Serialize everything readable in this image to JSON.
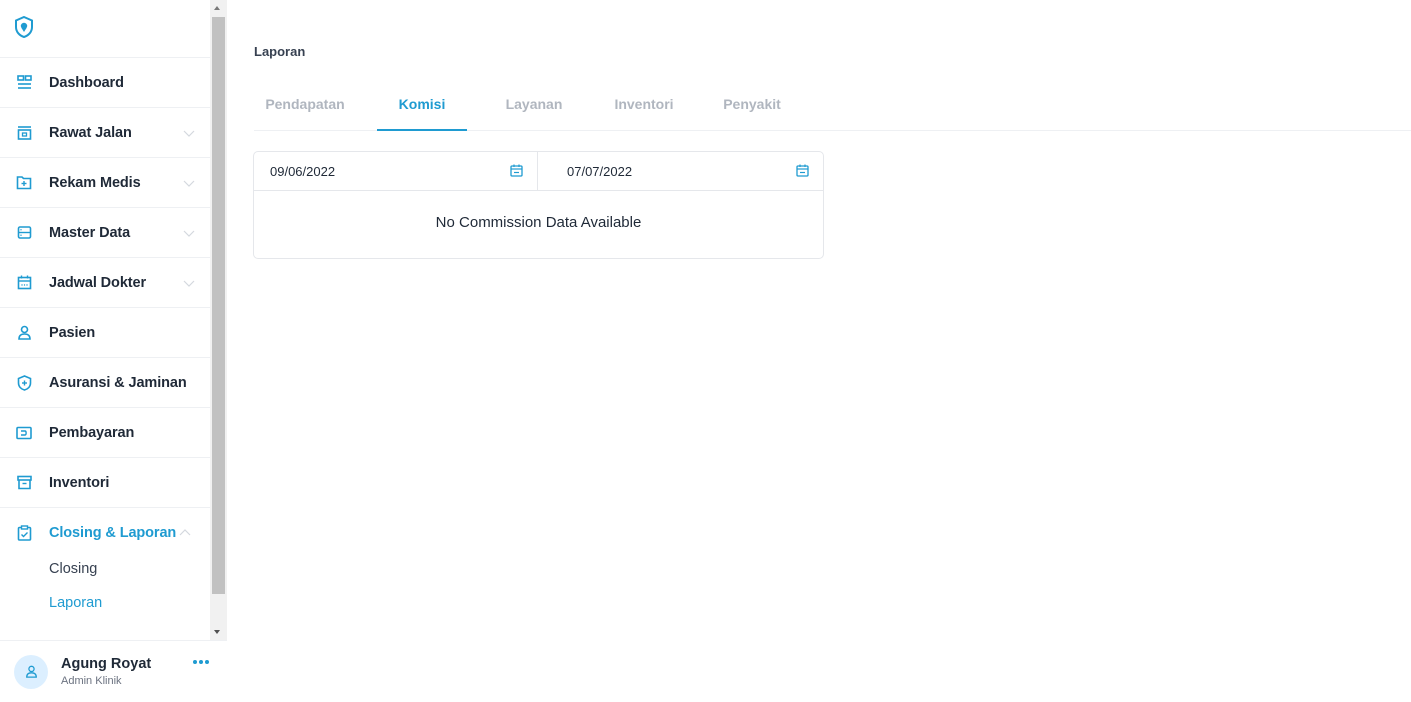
{
  "sidebar": {
    "items": [
      {
        "label": "Dashboard"
      },
      {
        "label": "Rawat Jalan"
      },
      {
        "label": "Rekam Medis"
      },
      {
        "label": "Master Data"
      },
      {
        "label": "Jadwal Dokter"
      },
      {
        "label": "Pasien"
      },
      {
        "label": "Asuransi & Jaminan"
      },
      {
        "label": "Pembayaran"
      },
      {
        "label": "Inventori"
      },
      {
        "label": "Closing & Laporan"
      }
    ],
    "sub_items": [
      {
        "label": "Closing"
      },
      {
        "label": "Laporan"
      }
    ]
  },
  "user": {
    "name": "Agung Royat",
    "role": "Admin Klinik"
  },
  "page": {
    "title": "Laporan"
  },
  "tabs": [
    {
      "label": "Pendapatan"
    },
    {
      "label": "Komisi"
    },
    {
      "label": "Layanan"
    },
    {
      "label": "Inventori"
    },
    {
      "label": "Penyakit"
    }
  ],
  "filters": {
    "start_date": "09/06/2022",
    "end_date": "07/07/2022"
  },
  "empty_message": "No Commission Data Available",
  "colors": {
    "accent": "#1f9bd1",
    "text": "#1f2937",
    "muted": "#b0b6bf"
  },
  "icons": {
    "logo": "location-shield-icon",
    "menu": "more-horizontal-icon"
  }
}
